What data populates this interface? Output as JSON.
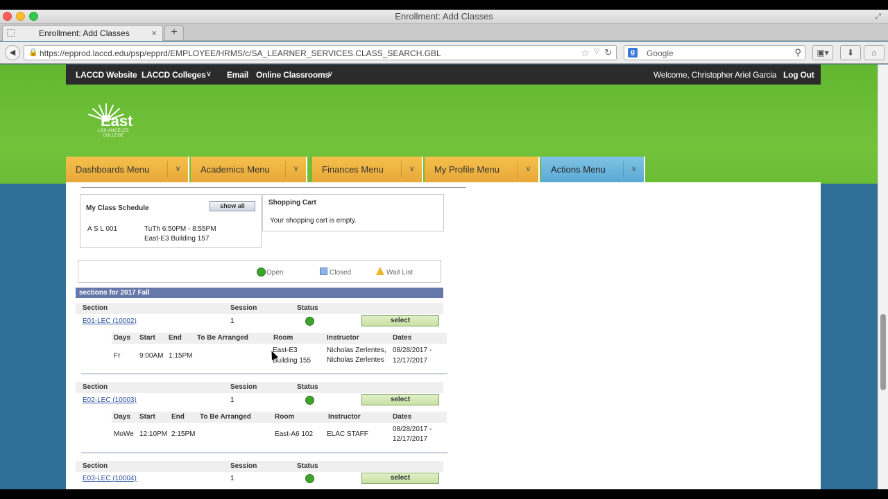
{
  "window": {
    "title": "Enrollment: Add Classes"
  },
  "tab": {
    "label": "Enrollment: Add Classes",
    "close": "×",
    "new": "+"
  },
  "nav": {
    "url": "https://epprod.laccd.edu/psp/epprd/EMPLOYEE/HRMS/c/SA_LEARNER_SERVICES.CLASS_SEARCH.GBL",
    "search_placeholder": "Google"
  },
  "topnav": {
    "links": [
      "LACCD Website",
      "LACCD Colleges",
      "Email",
      "Online Classrooms"
    ],
    "welcome": "Welcome, Christopher Ariel Garcia",
    "logout": "Log Out"
  },
  "logo": {
    "name": "East",
    "sub1": "LOS ANGELES",
    "sub2": "COLLEGE"
  },
  "menus": [
    "Dashboards Menu",
    "Academics Menu",
    "Finances Menu",
    "My Profile Menu",
    "Actions Menu"
  ],
  "schedule": {
    "title": "My Class Schedule",
    "show_all": "show all",
    "course": "A S L 001",
    "time": "TuTh 6:50PM - 8:55PM",
    "room": "East-E3 Building 157"
  },
  "cart": {
    "title": "Shopping Cart",
    "message": "Your shopping cart is empty."
  },
  "legend": {
    "open": "Open",
    "closed": "Closed",
    "waitlist": "Wait List"
  },
  "sections_header": "sections for 2017 Fall",
  "headers": {
    "section": "Section",
    "session": "Session",
    "status": "Status",
    "days": "Days",
    "start": "Start",
    "end": "End",
    "tba": "To Be Arranged",
    "room": "Room",
    "instructor": "Instructor",
    "dates": "Dates"
  },
  "select_label": "select",
  "sections": [
    {
      "id": "E01-LEC (10002)",
      "session": "1",
      "days": "Fr",
      "start": "9:00AM",
      "end": "1:15PM",
      "room1": "East-E3",
      "room2": "Building 155",
      "instr1": "Nicholas Zerlentes,",
      "instr2": "Nicholas Zerlentes",
      "date1": "08/28/2017 -",
      "date2": "12/17/2017"
    },
    {
      "id": "E02-LEC (10003)",
      "session": "1",
      "days": "MoWe",
      "start": "12:10PM",
      "end": "2:15PM",
      "room1": "East-A6 102",
      "room2": "",
      "instr1": "ELAC STAFF",
      "instr2": "",
      "date1": "08/28/2017 -",
      "date2": "12/17/2017"
    },
    {
      "id": "E03-LEC (10004)",
      "session": "1"
    }
  ],
  "colors": {
    "accent_green": "#6bbd35",
    "menu_orange": "#f0b440",
    "menu_blue": "#6cb7de",
    "section_bar": "#6677aa"
  }
}
